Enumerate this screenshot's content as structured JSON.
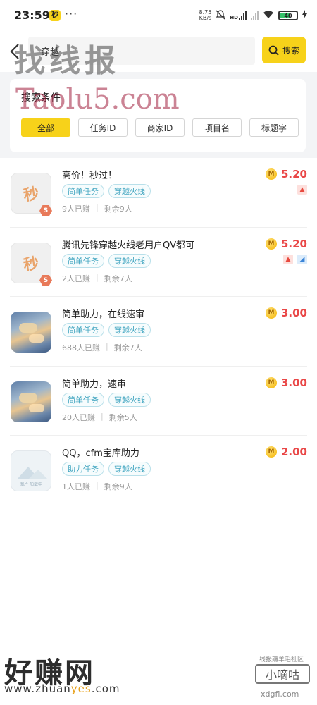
{
  "status_bar": {
    "time": "23:59",
    "app_icon_glyph": "秒",
    "dots": "···",
    "net_speed": "8.75\nKB/s",
    "signal_label": "HD",
    "battery_level": "40"
  },
  "header": {
    "search_value": "穿越",
    "search_button_label": "搜索"
  },
  "conditions": {
    "title": "搜索条件",
    "filters": [
      {
        "label": "全部",
        "active": true
      },
      {
        "label": "任务ID",
        "active": false
      },
      {
        "label": "商家ID",
        "active": false
      },
      {
        "label": "项目名",
        "active": false
      },
      {
        "label": "标题字",
        "active": false
      }
    ]
  },
  "tasks": [
    {
      "title": "高价！秒过！",
      "thumb": "miao",
      "thumb_glyph": "秒",
      "badge": "S",
      "tags": [
        "简单任务",
        "穿越火线"
      ],
      "earned": "9人已赚",
      "remaining": "剩余9人",
      "reward": "5.20",
      "flags": [
        "top"
      ]
    },
    {
      "title": "腾讯先锋穿越火线老用户QV都可",
      "thumb": "miao",
      "thumb_glyph": "秒",
      "badge": "S",
      "tags": [
        "简单任务",
        "穿越火线"
      ],
      "earned": "2人已赚",
      "remaining": "剩余7人",
      "reward": "5.20",
      "flags": [
        "top",
        "chart"
      ]
    },
    {
      "title": "简单助力，在线速审",
      "thumb": "sky",
      "tags": [
        "简单任务",
        "穿越火线"
      ],
      "earned": "688人已赚",
      "remaining": "剩余7人",
      "reward": "3.00",
      "flags": []
    },
    {
      "title": "简单助力，速审",
      "thumb": "sky",
      "tags": [
        "简单任务",
        "穿越火线"
      ],
      "earned": "20人已赚",
      "remaining": "剩余5人",
      "reward": "3.00",
      "flags": []
    },
    {
      "title": "QQ，cfm宝库助力",
      "thumb": "placeholder",
      "thumb_caption": "图片 加载中",
      "tags": [
        "助力任务",
        "穿越火线"
      ],
      "earned": "1人已赚",
      "remaining": "剩余9人",
      "reward": "2.00",
      "flags": []
    }
  ],
  "coin_glyph": "M",
  "watermarks": {
    "title": "找线报",
    "taolu": "Taolu5.com",
    "hzw": "好赚网",
    "hzw_url_pre": "www.zhuan",
    "hzw_url_hl": "yes",
    "hzw_url_post": ".com",
    "xdg_top": "线报薅羊毛社区",
    "xdg": "小嘀咕",
    "xdg_url": "xdgfl.com"
  },
  "colors": {
    "accent": "#f7d21a",
    "reward": "#e94747",
    "tag": "#43a6c1"
  }
}
